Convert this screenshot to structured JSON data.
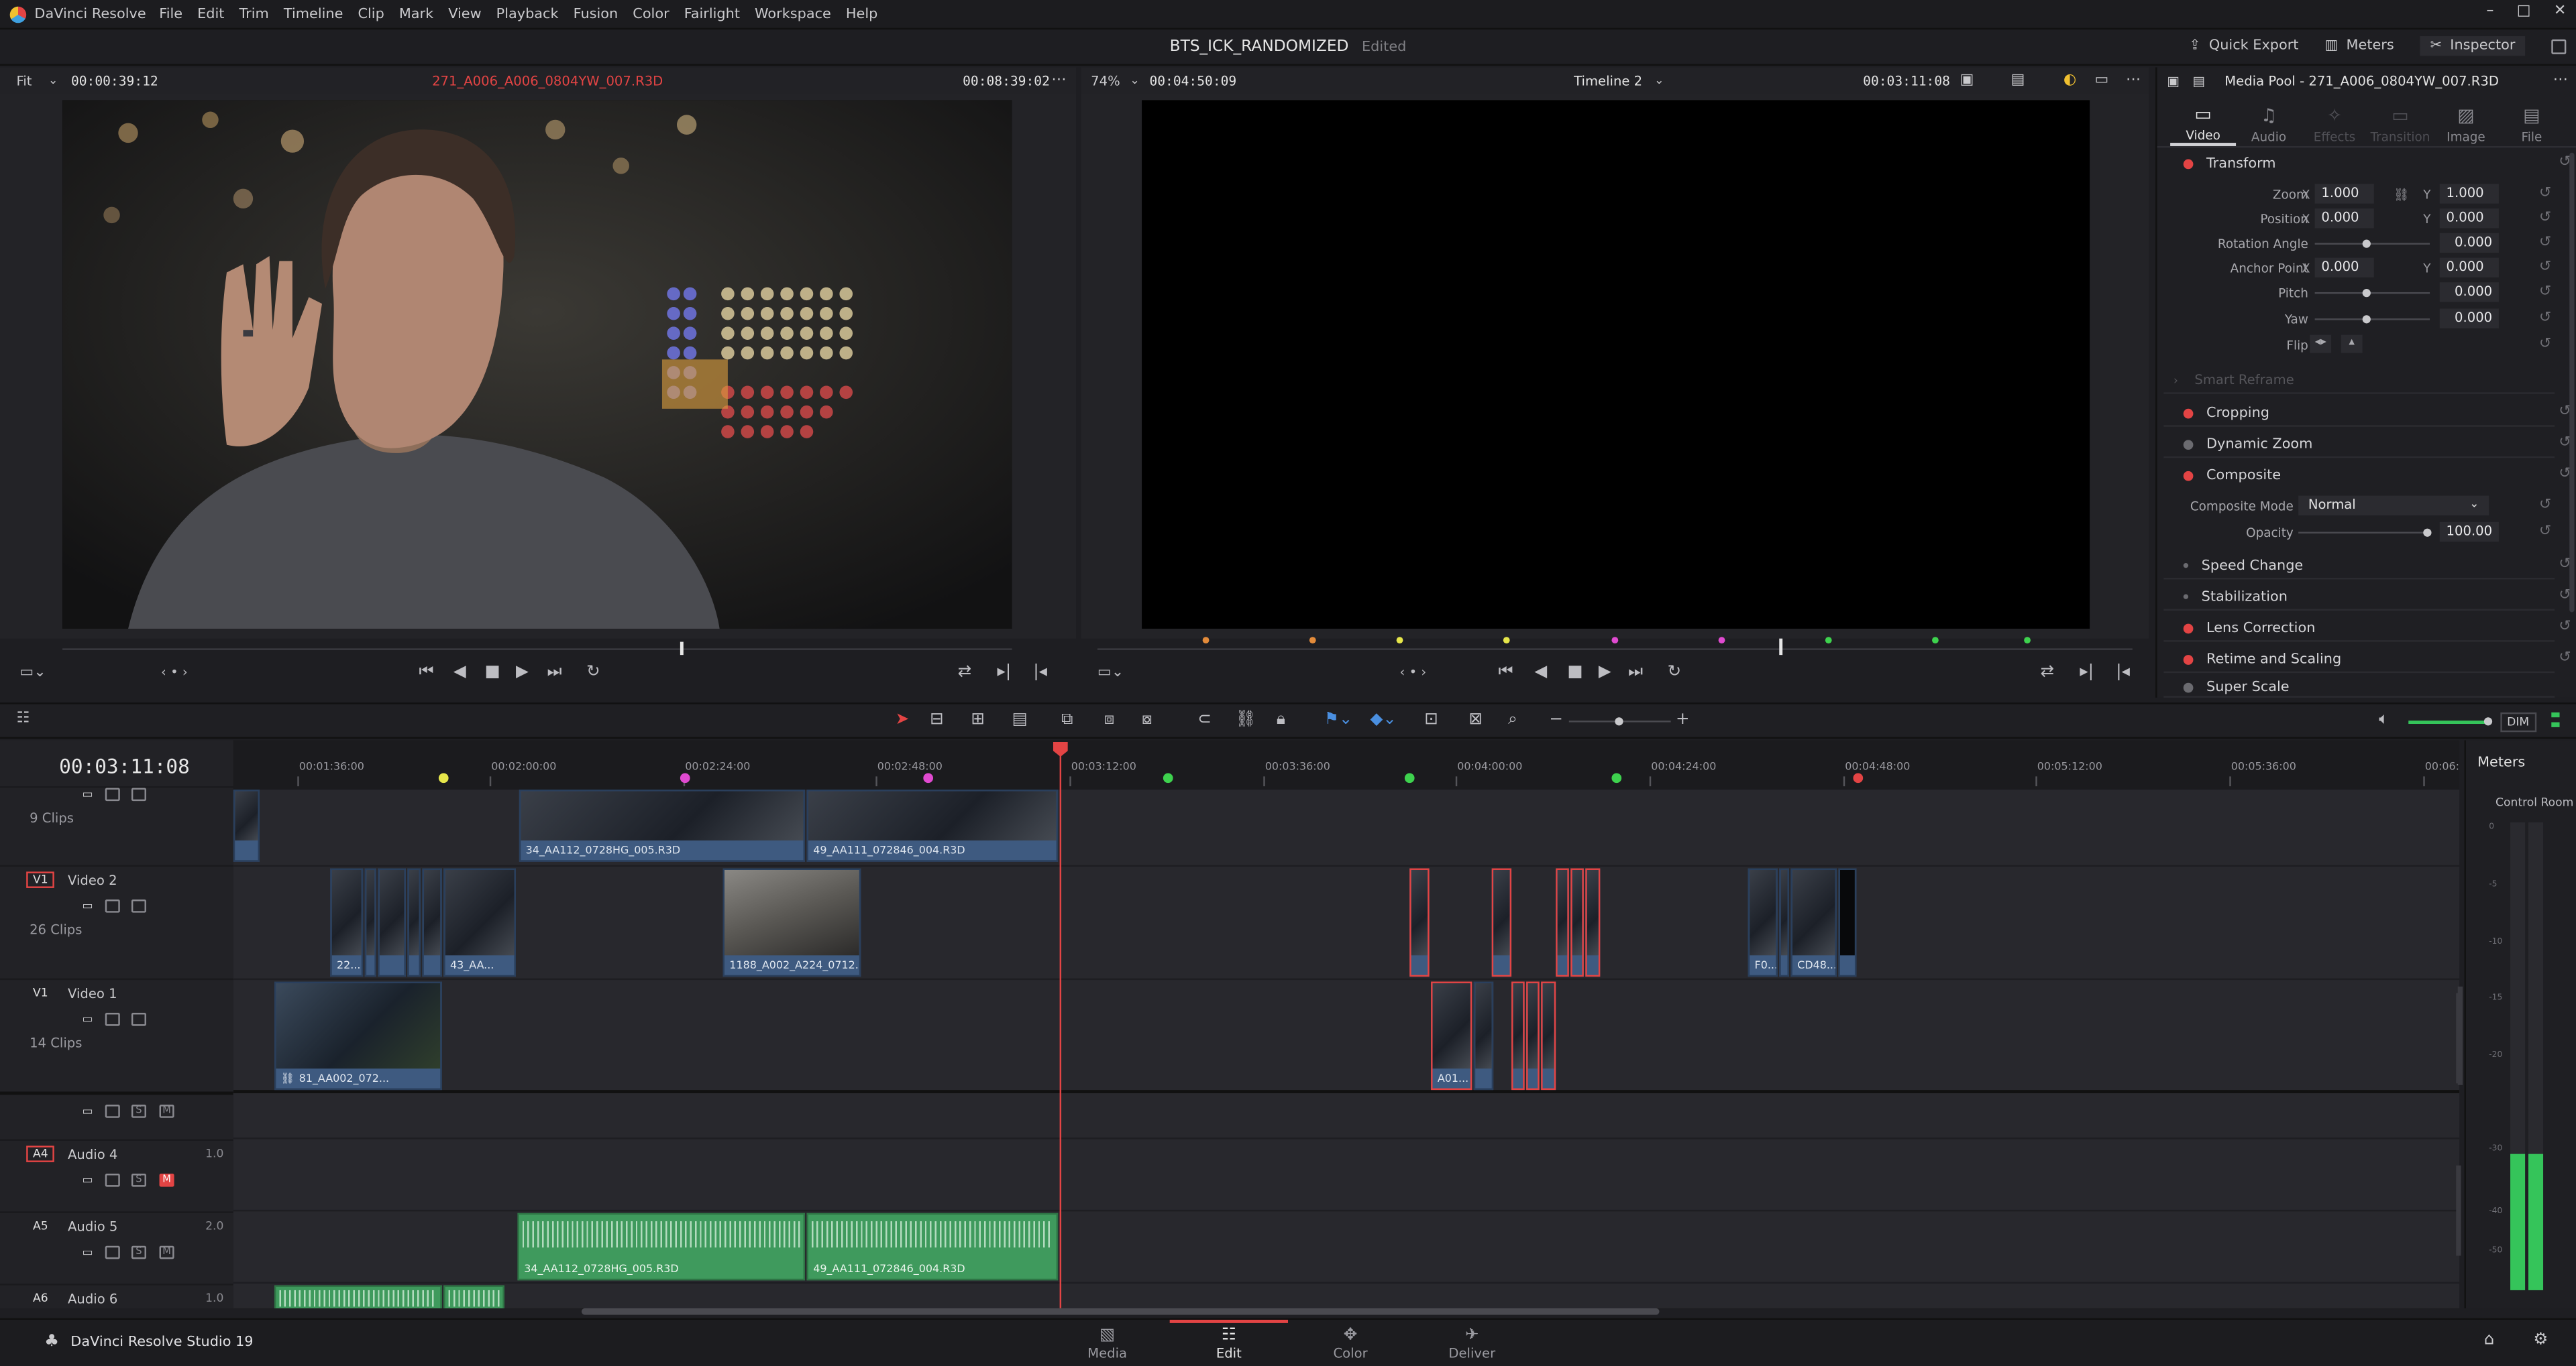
{
  "menubar": {
    "app_name": "DaVinci Resolve",
    "items": [
      "File",
      "Edit",
      "Trim",
      "Timeline",
      "Clip",
      "Mark",
      "View",
      "Playback",
      "Fusion",
      "Color",
      "Fairlight",
      "Workspace",
      "Help"
    ]
  },
  "titlebar": {
    "project": "BTS_ICK_RANDOMIZED",
    "status": "Edited",
    "quick_export": "Quick Export",
    "meters": "Meters",
    "inspector": "Inspector"
  },
  "source": {
    "zoom": "Fit",
    "timecode_in": "00:00:39:12",
    "clip_name": "271_A006_A006_0804YW_007.R3D",
    "duration": "00:08:39:02"
  },
  "record": {
    "zoom": "74%",
    "timecode": "00:04:50:09",
    "timeline_name": "Timeline 2",
    "duration": "00:03:11:08"
  },
  "inspector": {
    "title": "Media Pool - 271_A006_0804YW_007.R3D",
    "tabs": [
      {
        "label": "Video",
        "icon": "video-tab-icon",
        "active": true
      },
      {
        "label": "Audio",
        "icon": "audio-tab-icon",
        "active": false
      },
      {
        "label": "Effects",
        "icon": "effects-tab-icon",
        "active": false,
        "dim": true
      },
      {
        "label": "Transition",
        "icon": "transition-tab-icon",
        "active": false,
        "dim": true
      },
      {
        "label": "Image",
        "icon": "image-tab-icon",
        "active": false
      },
      {
        "label": "File",
        "icon": "file-tab-icon",
        "active": false
      }
    ],
    "transform": {
      "title": "Transform",
      "zoom_label": "Zoom",
      "zoom_x": "1.000",
      "zoom_y": "1.000",
      "position_label": "Position",
      "pos_x": "0.000",
      "pos_y": "0.000",
      "rotation_label": "Rotation Angle",
      "rotation": "0.000",
      "anchor_label": "Anchor Point",
      "anchor_x": "0.000",
      "anchor_y": "0.000",
      "pitch_label": "Pitch",
      "pitch": "0.000",
      "yaw_label": "Yaw",
      "yaw": "0.000",
      "flip_label": "Flip",
      "x": "X",
      "y": "Y"
    },
    "smart_reframe": "Smart Reframe",
    "cropping": "Cropping",
    "dynamic_zoom": "Dynamic Zoom",
    "composite": {
      "title": "Composite",
      "mode_label": "Composite Mode",
      "mode_value": "Normal",
      "opacity_label": "Opacity",
      "opacity_value": "100.00",
      "opacity_level": 1.0
    },
    "speed_change": "Speed Change",
    "stabilization": "Stabilization",
    "lens_correction": "Lens Correction",
    "retime_scaling": "Retime and Scaling",
    "super_scale": "Super Scale"
  },
  "timeline": {
    "timecode": "00:03:11:08",
    "ruler": [
      "00:01:36:00",
      "00:02:00:00",
      "00:02:24:00",
      "00:02:48:00",
      "00:03:12:00",
      "00:03:36:00",
      "00:04:00:00",
      "00:04:24:00",
      "00:04:48:00",
      "00:05:12:00",
      "00:05:36:00",
      "00:06:"
    ],
    "dim_label": "DIM",
    "tracks": {
      "v3_clips": "9 Clips",
      "v2_id": "V1",
      "v2_name": "Video 2",
      "v2_clips": "26 Clips",
      "v1_id": "V1",
      "v1_name": "Video 1",
      "v1_clips": "14 Clips",
      "a4_id": "A4",
      "a4_name": "Audio 4",
      "a4_ch": "1.0",
      "a5_id": "A5",
      "a5_name": "Audio 5",
      "a5_ch": "2.0",
      "a6_id": "A6",
      "a6_name": "Audio 6",
      "a6_ch": "1.0",
      "s": "S",
      "m": "M"
    },
    "clips": {
      "v3_a": "34_AA112_0728HG_005.R3D",
      "v3_b": "49_AA111_072846_004.R3D",
      "v2_a": "22...",
      "v2_b": "43_AA...",
      "v2_c": "1188_A002_A224_0712...",
      "v2_d": "F0...",
      "v2_e": "CD48...",
      "v1_a": "81_AA002_072...",
      "v1_b": "A01...",
      "a5_a": "34_AA112_0728HG_005.R3D",
      "a5_b": "49_AA111_072846_004.R3D"
    }
  },
  "meters": {
    "title": "Meters",
    "subtitle": "Control Room",
    "scale": [
      "0",
      "-5",
      "-10",
      "-15",
      "-20",
      "-30",
      "-40",
      "-50"
    ],
    "left_level": 0.29,
    "right_level": 0.29
  },
  "bottom": {
    "product": "DaVinci Resolve Studio 19",
    "pages": [
      {
        "label": "Media",
        "active": false
      },
      {
        "label": "Edit",
        "active": true
      },
      {
        "label": "Color",
        "active": false
      },
      {
        "label": "Deliver",
        "active": false
      }
    ]
  },
  "colors": {
    "accent_red": "#e34444",
    "video_clip": "#3e5a80",
    "audio_clip": "#3f9a5d"
  }
}
